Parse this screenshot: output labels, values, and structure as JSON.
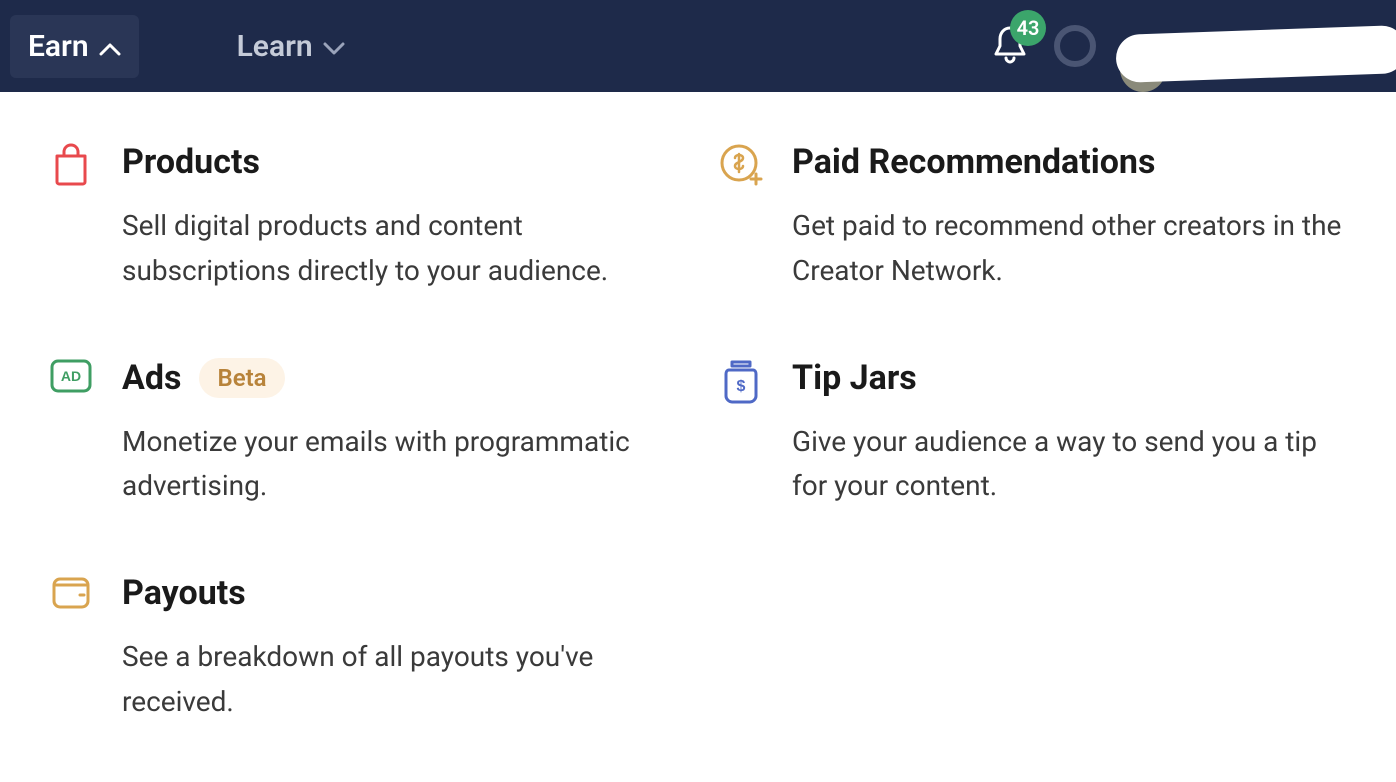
{
  "nav": {
    "earn": "Earn",
    "learn": "Learn"
  },
  "notifications": {
    "count": "43"
  },
  "cards": {
    "products": {
      "title": "Products",
      "desc": "Sell digital products and content subscriptions directly to your audience."
    },
    "paidRecs": {
      "title": "Paid Recommendations",
      "desc": "Get paid to recommend other creators in the Creator Network."
    },
    "ads": {
      "title": "Ads",
      "badge": "Beta",
      "desc": "Monetize your emails with programmatic advertising."
    },
    "tipJars": {
      "title": "Tip Jars",
      "desc": "Give your audience a way to send you a tip for your content."
    },
    "payouts": {
      "title": "Payouts",
      "desc": "See a breakdown of all payouts you've received."
    }
  }
}
